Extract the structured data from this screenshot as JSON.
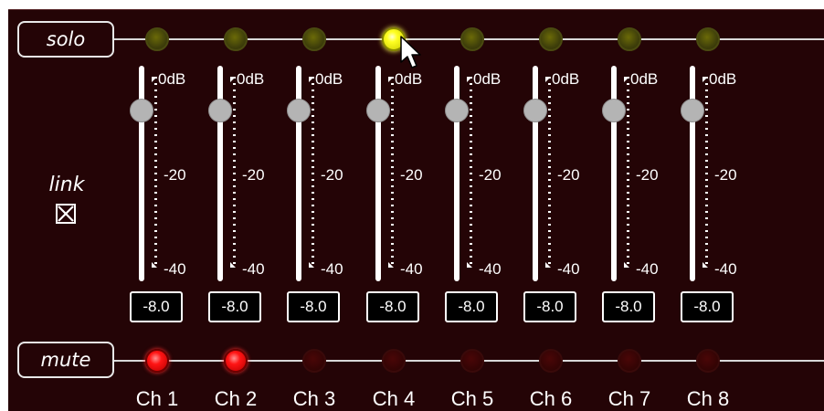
{
  "solo_label": "solo",
  "mute_label": "mute",
  "link_label": "link",
  "link_checked": true,
  "scale": {
    "top": "0dB",
    "mid": "-20",
    "bottom": "-40"
  },
  "colors": {
    "panel_bg": "#240406",
    "solo_on": "#ffff22",
    "solo_off": "#40400a",
    "mute_on": "#ff1414",
    "mute_off": "#320404"
  },
  "channels": [
    {
      "label": "Ch 1",
      "value": "-8.0",
      "solo": false,
      "mute": true
    },
    {
      "label": "Ch 2",
      "value": "-8.0",
      "solo": false,
      "mute": true
    },
    {
      "label": "Ch 3",
      "value": "-8.0",
      "solo": false,
      "mute": false
    },
    {
      "label": "Ch 4",
      "value": "-8.0",
      "solo": true,
      "mute": false
    },
    {
      "label": "Ch 5",
      "value": "-8.0",
      "solo": false,
      "mute": false
    },
    {
      "label": "Ch 6",
      "value": "-8.0",
      "solo": false,
      "mute": false
    },
    {
      "label": "Ch 7",
      "value": "-8.0",
      "solo": false,
      "mute": false
    },
    {
      "label": "Ch 8",
      "value": "-8.0",
      "solo": false,
      "mute": false
    }
  ]
}
